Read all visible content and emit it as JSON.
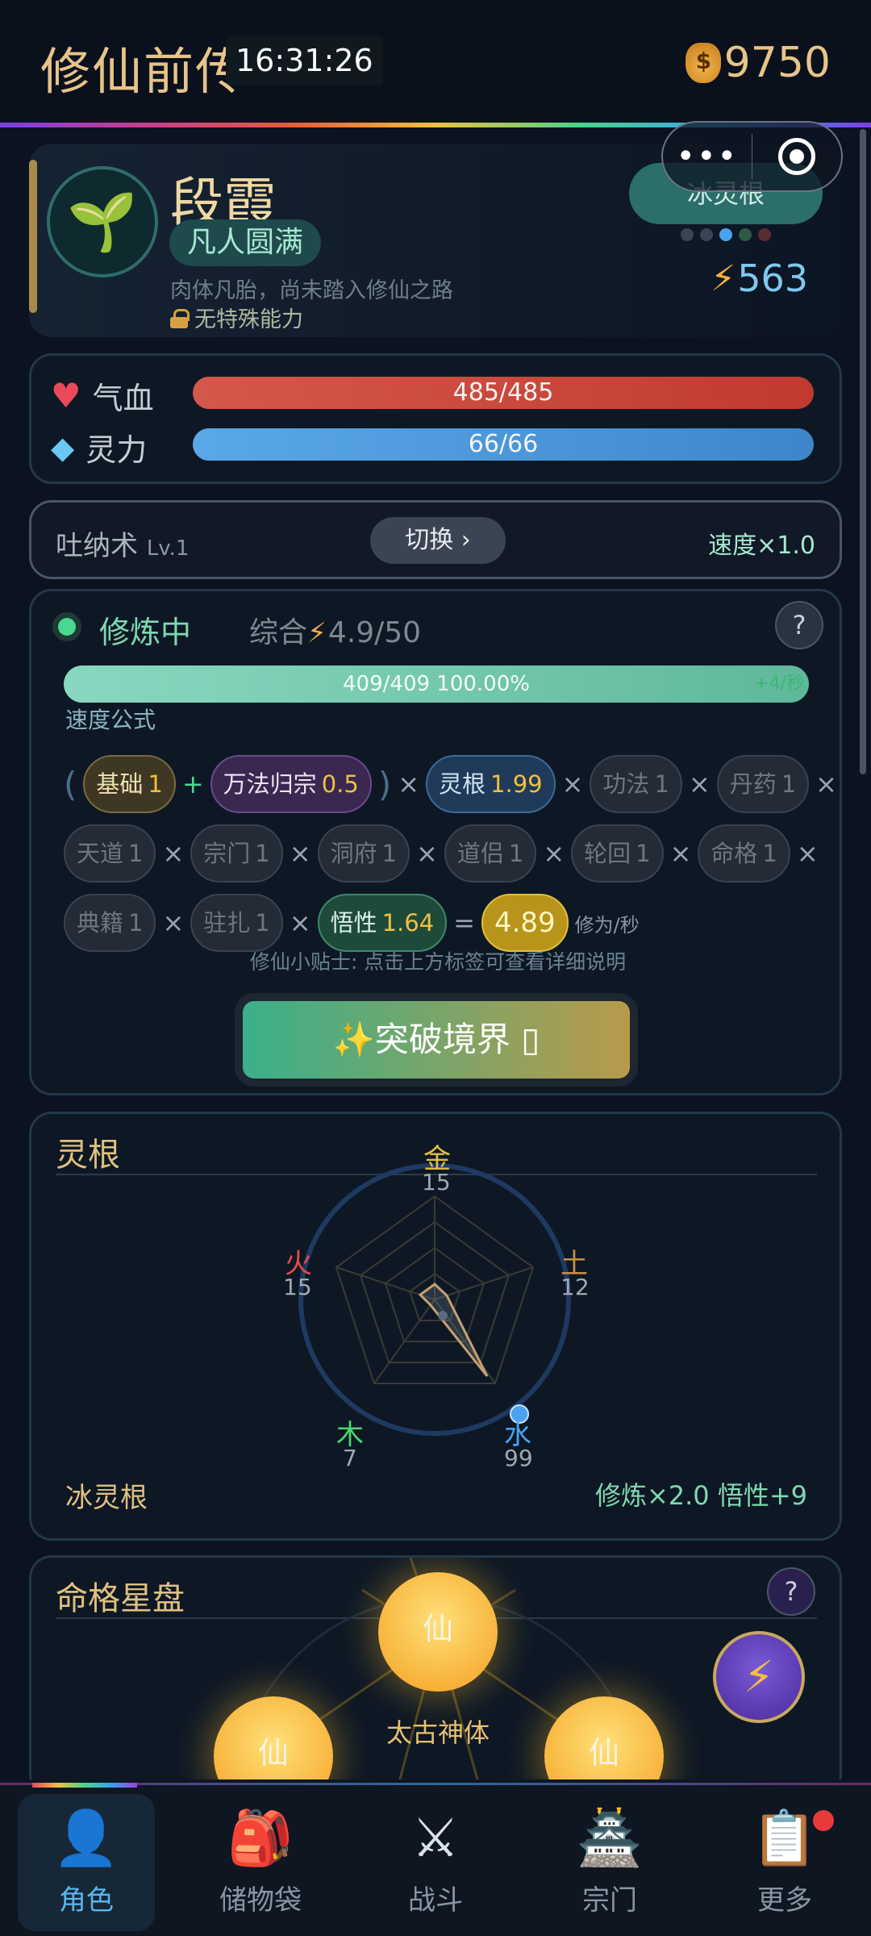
{
  "header": {
    "title": "修仙前传",
    "clock": "16:31:26",
    "coins": "9750"
  },
  "profile": {
    "name": "段霞",
    "realm": "凡人圆满",
    "description": "肉体凡胎，尚未踏入修仙之路",
    "ability": "无特殊能力",
    "root_button": "冰灵根",
    "power": "563"
  },
  "stats": {
    "hp": {
      "label": "气血",
      "value": "485/485"
    },
    "mp": {
      "label": "灵力",
      "value": "66/66"
    }
  },
  "technique": {
    "name": "吐纳术",
    "level": "Lv.1",
    "switch_label": "切换 ›",
    "speed": "速度×1.0"
  },
  "cultivation": {
    "status": "修炼中",
    "combined_label": "综合",
    "combined_value": "4.9/50",
    "help": "?",
    "progress_text": "409/409  100.00%",
    "progress_gain": "+4/秒",
    "formula_label": "速度公式",
    "chips": {
      "base": {
        "label": "基础",
        "value": "1"
      },
      "wanfa": {
        "label": "万法归宗",
        "value": "0.5"
      },
      "root": {
        "label": "灵根",
        "value": "1.99"
      },
      "gongfa": {
        "label": "功法",
        "value": "1"
      },
      "danyao": {
        "label": "丹药",
        "value": "1"
      },
      "tiandao": {
        "label": "天道",
        "value": "1"
      },
      "zongmen": {
        "label": "宗门",
        "value": "1"
      },
      "dongfu": {
        "label": "洞府",
        "value": "1"
      },
      "daolv": {
        "label": "道侣",
        "value": "1"
      },
      "lunhui": {
        "label": "轮回",
        "value": "1"
      },
      "mingge": {
        "label": "命格",
        "value": "1"
      },
      "dianji": {
        "label": "典籍",
        "value": "1"
      },
      "zhuzha": {
        "label": "驻扎",
        "value": "1"
      },
      "wuxing": {
        "label": "悟性",
        "value": "1.64"
      },
      "result": "4.89",
      "unit": "修为/秒"
    },
    "tip": "修仙小贴士: 点击上方标签可查看详细说明",
    "breakthrough": "✨突破境界 ▯"
  },
  "spirit_roots": {
    "title": "灵根",
    "elements": {
      "metal": {
        "label": "金",
        "value": "15"
      },
      "earth": {
        "label": "土",
        "value": "12"
      },
      "water": {
        "label": "水",
        "value": "99"
      },
      "wood": {
        "label": "木",
        "value": "7"
      },
      "fire": {
        "label": "火",
        "value": "15"
      }
    },
    "root_name": "冰灵根",
    "bonus": "修炼×2.0  悟性+9"
  },
  "fate": {
    "title": "命格星盘",
    "help": "?",
    "star_char": "仙",
    "center_label": "太古神体"
  },
  "tabs": [
    {
      "label": "角色"
    },
    {
      "label": "储物袋"
    },
    {
      "label": "战斗"
    },
    {
      "label": "宗门"
    },
    {
      "label": "更多"
    }
  ],
  "colors": {
    "accent": "#5ab4f0",
    "gold": "#e8c489",
    "hp": "#d4594a",
    "mp": "#5aa8e8",
    "cultivate": "#7fd8b0"
  }
}
